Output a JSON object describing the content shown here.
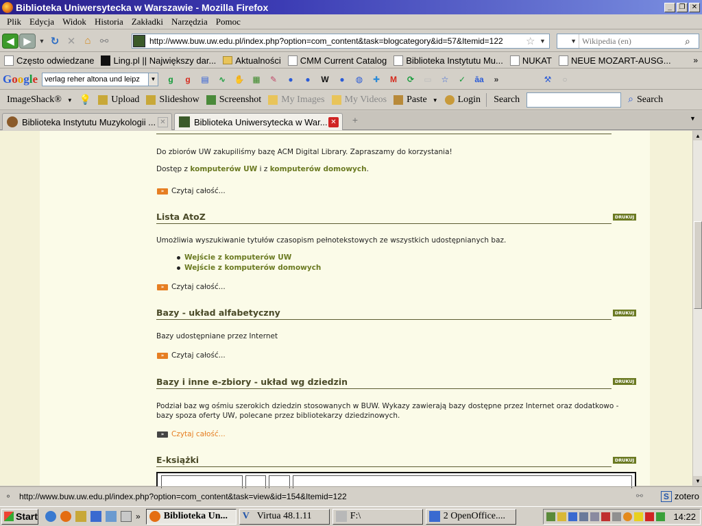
{
  "window": {
    "title": "Biblioteka Uniwersytecka w Warszawie - Mozilla Firefox",
    "buttons": {
      "minimize": "_",
      "maximize": "❐",
      "close": "✕"
    }
  },
  "menu": [
    "Plik",
    "Edycja",
    "Widok",
    "Historia",
    "Zakładki",
    "Narzędzia",
    "Pomoc"
  ],
  "nav": {
    "url": "http://www.buw.uw.edu.pl/index.php?option=com_content&task=blogcategory&id=57&Itemid=122",
    "search_placeholder": "Wikipedia (en)"
  },
  "bookmarks": [
    "Często odwiedzane",
    "Ling.pl || Największy dar...",
    "Aktualności",
    "CMM Current Catalog",
    "Biblioteka Instytutu Mu...",
    "NUKAT",
    "NEUE MOZART-AUSG..."
  ],
  "bookmarks_more": "»",
  "google": {
    "logo": [
      "G",
      "o",
      "o",
      "g",
      "l",
      "e"
    ],
    "query": "verlag reher altona und leipz"
  },
  "imageshack": {
    "items": [
      "ImageShack®",
      "Upload",
      "Slideshow",
      "Screenshot",
      "My Images",
      "My Videos",
      "Paste",
      "Login"
    ],
    "search_label": "Search",
    "search_button": "Search"
  },
  "tabs": [
    {
      "title": "Biblioteka Instytutu Muzykologii ..."
    },
    {
      "title": "Biblioteka Uniwersytecka w War..."
    }
  ],
  "content": {
    "intro_text": "Do zbiorów UW zakupiliśmy bazę ACM Digital Library. Zapraszamy do korzystania!",
    "access_prefix": "Dostęp z ",
    "access_link1": "komputerów UW",
    "access_mid": " i z ",
    "access_link2": "komputerów domowych",
    "access_suffix": ".",
    "read_more": "Czytaj całość...",
    "print_label": "DRUKUJ",
    "articles": [
      {
        "title": "Lista AtoZ",
        "text": "Umożliwia wyszukiwanie tytułów czasopism pełnotekstowych ze wszystkich udostępnianych baz.",
        "bullets": [
          "Wejście z komputerów UW",
          "Wejście z komputerów domowych"
        ]
      },
      {
        "title": "Bazy - układ alfabetyczny",
        "text": "Bazy udostępniane przez Internet"
      },
      {
        "title": "Bazy i inne e-zbiory - układ wg dziedzin",
        "text": "Podział baz wg ośmiu szerokich dziedzin stosowanych w BUW. Wykazy zawierają bazy dostępne przez Internet oraz dodatkowo - bazy spoza oferty UW, polecane przez bibliotekarzy dziedzinowych."
      },
      {
        "title": "E-książki"
      }
    ]
  },
  "status": {
    "url": "http://www.buw.uw.edu.pl/index.php?option=com_content&task=view&id=154&Itemid=122",
    "zotero": "zotero",
    "zotero_icon": "S"
  },
  "taskbar": {
    "start": "Start",
    "items": [
      "Biblioteka Un...",
      "Virtua 48.1.11",
      "F:\\",
      "2 OpenOffice...."
    ],
    "clock": "14:22"
  }
}
